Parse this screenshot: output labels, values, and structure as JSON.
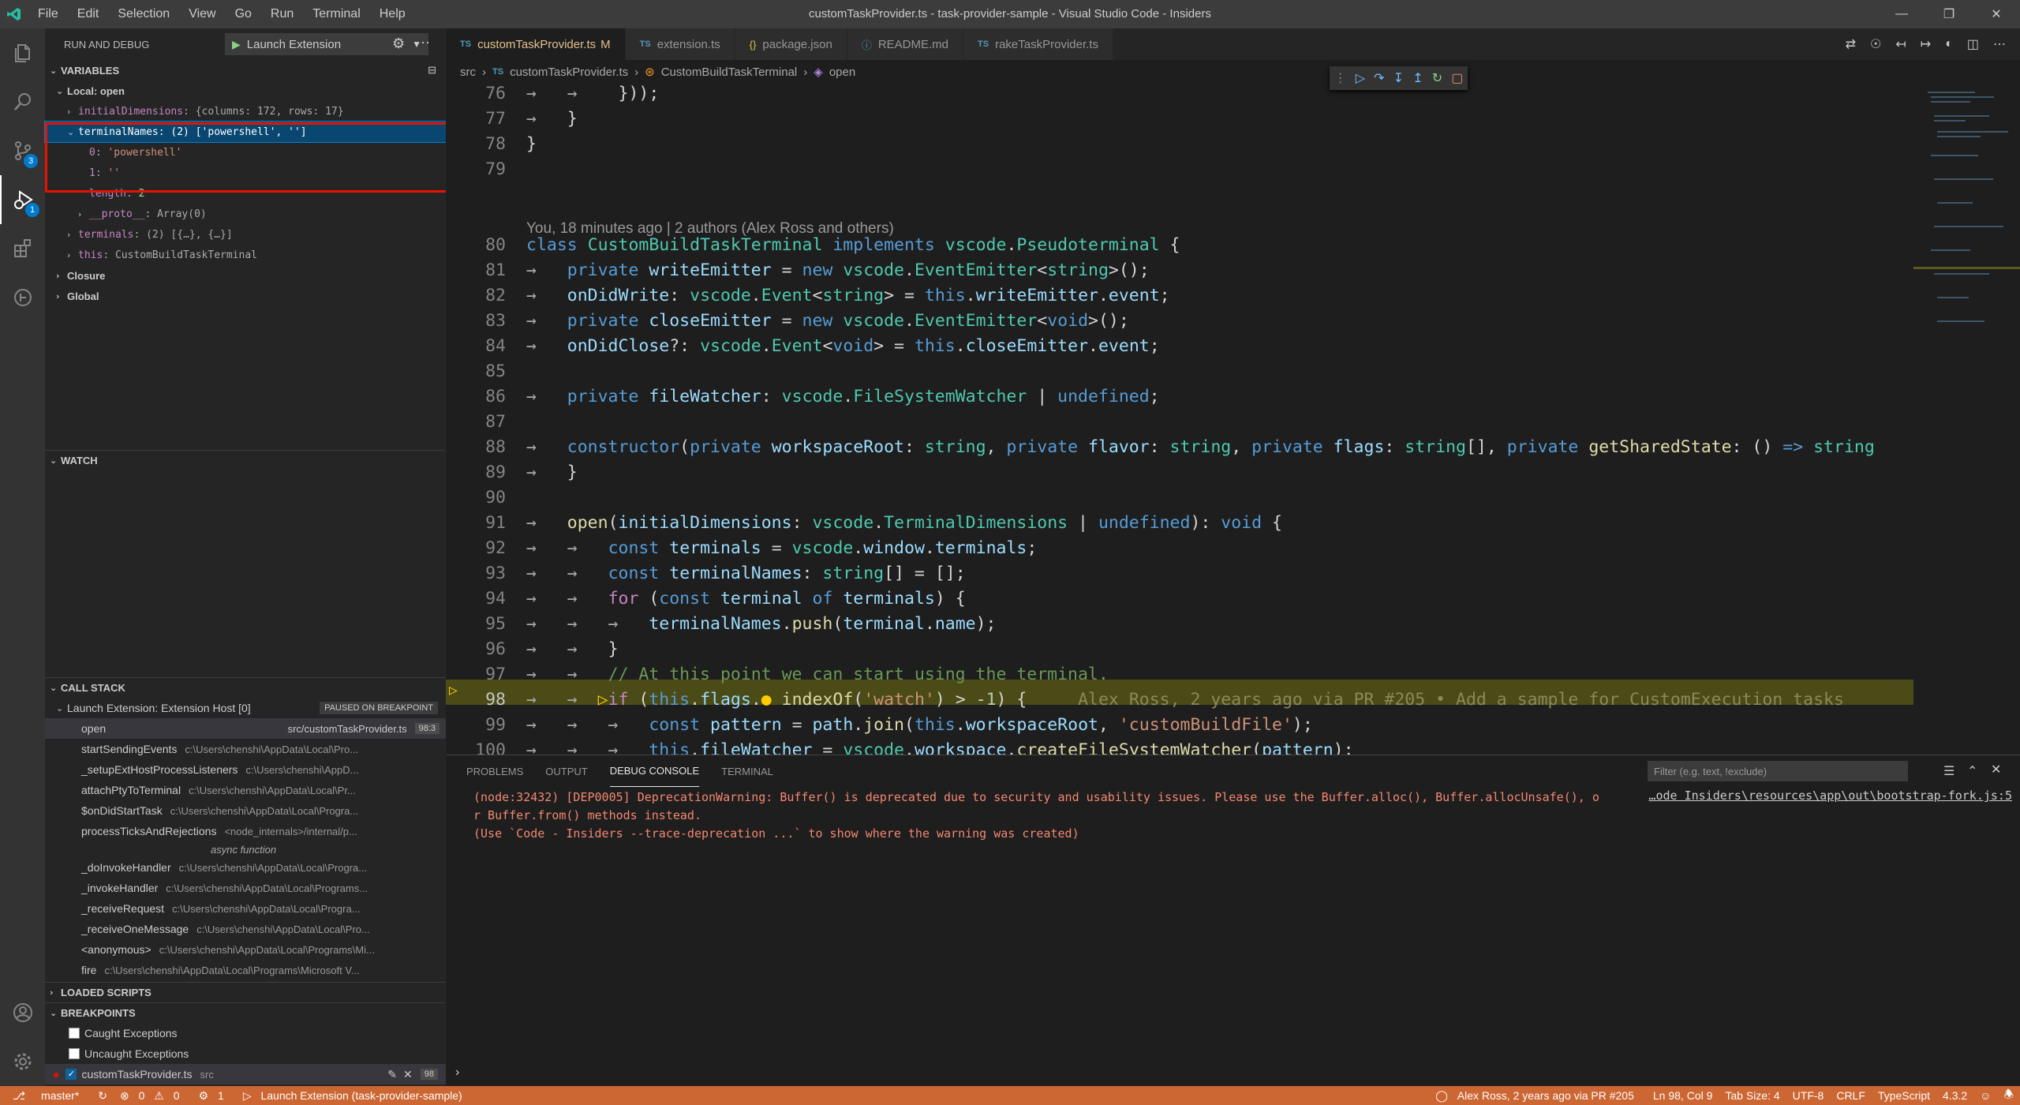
{
  "window": {
    "title": "customTaskProvider.ts - task-provider-sample - Visual Studio Code - Insiders"
  },
  "menu": [
    "File",
    "Edit",
    "Selection",
    "View",
    "Go",
    "Run",
    "Terminal",
    "Help"
  ],
  "activity": {
    "scm_badge": "3",
    "debug_badge": "1"
  },
  "sidebar": {
    "title": "RUN AND DEBUG",
    "launch_config": "Launch Extension",
    "variables": {
      "header": "VARIABLES",
      "scope_local": "Local: open",
      "rows": [
        {
          "name": "initialDimensions",
          "value": "{columns: 172, rows: 17}"
        },
        {
          "name": "terminalNames",
          "value": "(2) ['powershell', '']"
        },
        {
          "name": "0",
          "value": "'powershell'"
        },
        {
          "name": "1",
          "value": "''"
        },
        {
          "name": "length",
          "value": "2"
        },
        {
          "name": "__proto__",
          "value": "Array(0)"
        },
        {
          "name": "terminals",
          "value": "(2) [{…}, {…}]"
        },
        {
          "name": "this",
          "value": "CustomBuildTaskTerminal"
        }
      ],
      "scope_closure": "Closure",
      "scope_global": "Global"
    },
    "watch": {
      "header": "WATCH"
    },
    "call_stack": {
      "header": "CALL STACK",
      "session": "Launch Extension: Extension Host [0]",
      "paused": "PAUSED ON BREAKPOINT",
      "frames": [
        {
          "fn": "open",
          "path": "src/customTaskProvider.ts",
          "loc": "98:3"
        },
        {
          "fn": "startSendingEvents",
          "path": "c:\\Users\\chenshi\\AppData\\Local\\Pro..."
        },
        {
          "fn": "_setupExtHostProcessListeners",
          "path": "c:\\Users\\chenshi\\AppD..."
        },
        {
          "fn": "attachPtyToTerminal",
          "path": "c:\\Users\\chenshi\\AppData\\Local\\Pr..."
        },
        {
          "fn": "$onDidStartTask",
          "path": "c:\\Users\\chenshi\\AppData\\Local\\Progra..."
        },
        {
          "fn": "processTicksAndRejections",
          "path": "<node_internals>/internal/p..."
        },
        {
          "fn": "async function",
          "path": ""
        },
        {
          "fn": "_doInvokeHandler",
          "path": "c:\\Users\\chenshi\\AppData\\Local\\Progra..."
        },
        {
          "fn": "_invokeHandler",
          "path": "c:\\Users\\chenshi\\AppData\\Local\\Programs..."
        },
        {
          "fn": "_receiveRequest",
          "path": "c:\\Users\\chenshi\\AppData\\Local\\Progra..."
        },
        {
          "fn": "_receiveOneMessage",
          "path": "c:\\Users\\chenshi\\AppData\\Local\\Pro..."
        },
        {
          "fn": "<anonymous>",
          "path": "c:\\Users\\chenshi\\AppData\\Local\\Programs\\Mi..."
        },
        {
          "fn": "fire",
          "path": "c:\\Users\\chenshi\\AppData\\Local\\Programs\\Microsoft V..."
        }
      ]
    },
    "loaded_scripts": {
      "header": "LOADED SCRIPTS"
    },
    "breakpoints": {
      "header": "BREAKPOINTS",
      "items": [
        {
          "label": "Caught Exceptions",
          "checked": false
        },
        {
          "label": "Uncaught Exceptions",
          "checked": false
        },
        {
          "label": "customTaskProvider.ts",
          "dir": "src",
          "line": "98",
          "checked": true
        }
      ]
    }
  },
  "editor": {
    "tabs": [
      {
        "label": "customTaskProvider.ts",
        "flag": "M",
        "icon": "TS",
        "active": true
      },
      {
        "label": "extension.ts",
        "icon": "TS"
      },
      {
        "label": "package.json",
        "icon": "{}"
      },
      {
        "label": "README.md",
        "icon": "info"
      },
      {
        "label": "rakeTaskProvider.ts",
        "icon": "TS"
      }
    ],
    "breadcrumbs": [
      "src",
      "customTaskProvider.ts",
      "CustomBuildTaskTerminal",
      "open"
    ],
    "codelens": "You, 18 minutes ago | 2 authors (Alex Ross and others)",
    "inline_blame": "Alex Ross, 2 years ago via PR #205 • Add a sample for CustomExecution tasks",
    "line_numbers": [
      "76",
      "77",
      "78",
      "79",
      "80",
      "81",
      "82",
      "83",
      "84",
      "85",
      "86",
      "87",
      "88",
      "89",
      "90",
      "91",
      "92",
      "93",
      "94",
      "95",
      "96",
      "97",
      "98",
      "99",
      "100"
    ]
  },
  "panel": {
    "tabs": [
      "PROBLEMS",
      "OUTPUT",
      "DEBUG CONSOLE",
      "TERMINAL"
    ],
    "active_tab": "DEBUG CONSOLE",
    "filter_placeholder": "Filter (e.g. text, !exclude)",
    "console_lines": [
      "(node:32432) [DEP0005] DeprecationWarning: Buffer() is deprecated due to security and usability issues. Please use the Buffer.alloc(), Buffer.allocUnsafe(), o",
      "r Buffer.from() methods instead.",
      "(Use `Code - Insiders --trace-deprecation ...` to show where the warning was created)"
    ],
    "source_link": "…ode Insiders\\resources\\app\\out\\bootstrap-fork.js:5"
  },
  "statusbar": {
    "branch": "master*",
    "errors": "0",
    "warnings": "0",
    "debug_sessions": "1",
    "launch": "Launch Extension (task-provider-sample)",
    "blame": "Alex Ross, 2 years ago via PR #205",
    "position": "Ln 98, Col 9",
    "tab_size": "Tab Size: 4",
    "encoding": "UTF-8",
    "eol": "CRLF",
    "language": "TypeScript",
    "version": "4.3.2",
    "color": "#cc6633"
  }
}
